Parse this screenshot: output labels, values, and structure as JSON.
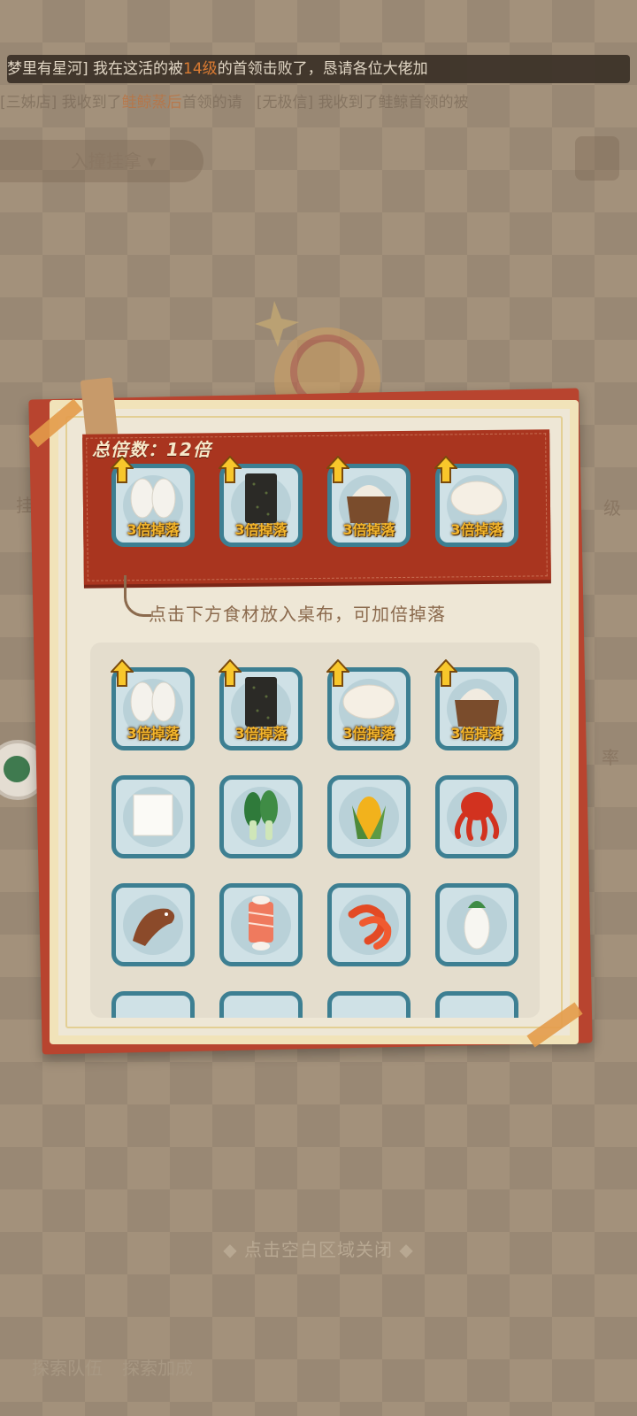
{
  "ticker": {
    "pre": "梦里有星河] 我在这活的被",
    "highlight": "14级",
    "post": "的首领击败了，恳请各位大佬加"
  },
  "ticker2": {
    "left": "[三姊店] 我收到了",
    "highlight": "鲑鲸蒸后",
    "mid": "首领的请",
    "right": "[无极信] 我收到了鲑鲸首领的被"
  },
  "background": {
    "dropdown_label": "入撞挂拿",
    "side_left": "挂",
    "side_right": "级",
    "side_right2": "率",
    "close_hint": "◆ 点击空白区域关闭 ◆",
    "bottom_left": "探索队伍",
    "bottom_right": "探索加成"
  },
  "panel": {
    "total_label": "总倍数：12倍",
    "hint": "点击下方食材放入桌布，可加倍掉落",
    "drop_tag": "3倍掉落",
    "table_slots": [
      {
        "food": "rice-balls-icon"
      },
      {
        "food": "seaweed-icon"
      },
      {
        "food": "flour-sack-icon"
      },
      {
        "food": "dough-icon"
      }
    ],
    "ingredients": [
      {
        "food": "rice-balls-icon",
        "boosted": true
      },
      {
        "food": "seaweed-icon",
        "boosted": true
      },
      {
        "food": "dough-icon",
        "boosted": true
      },
      {
        "food": "flour-sack-icon",
        "boosted": true
      },
      {
        "food": "tofu-icon",
        "boosted": false
      },
      {
        "food": "bok-choy-icon",
        "boosted": false
      },
      {
        "food": "corn-icon",
        "boosted": false
      },
      {
        "food": "octopus-icon",
        "boosted": false
      },
      {
        "food": "catfish-icon",
        "boosted": false
      },
      {
        "food": "salmon-steak-icon",
        "boosted": false
      },
      {
        "food": "shrimp-icon",
        "boosted": false
      },
      {
        "food": "daikon-icon",
        "boosted": false
      }
    ]
  },
  "colors": {
    "banner_red": "#a9351f",
    "card_border": "#3d7f92",
    "tag_yellow": "#f4b62c"
  }
}
